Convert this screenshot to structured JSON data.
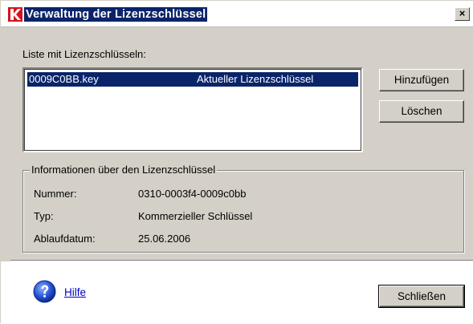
{
  "window": {
    "title": "Verwaltung der Lizenzschlüssel",
    "close_glyph": "×"
  },
  "keys": {
    "list_label": "Liste mit Lizenzschlüsseln:",
    "items": [
      {
        "file": "0009C0BB.key",
        "status": "Aktueller Lizenzschlüssel",
        "selected": true
      }
    ],
    "add_button": "Hinzufügen",
    "delete_button": "Löschen"
  },
  "info": {
    "group_title": "Informationen über den Lizenzschlüssel",
    "rows": [
      {
        "label": "Nummer:",
        "value": "0310-0003f4-0009c0bb"
      },
      {
        "label": "Typ:",
        "value": "Kommerzieller Schlüssel"
      },
      {
        "label": "Ablaufdatum:",
        "value": "25.06.2006"
      }
    ]
  },
  "footer": {
    "help_icon": "question-circle-icon",
    "help_link": "Hilfe",
    "close_button": "Schließen"
  },
  "colors": {
    "title_highlight": "#0a246a",
    "dialog_bg": "#d4d0c8",
    "selection": "#0a246a",
    "link": "#0000cc",
    "app_icon_red": "#d6121c"
  }
}
